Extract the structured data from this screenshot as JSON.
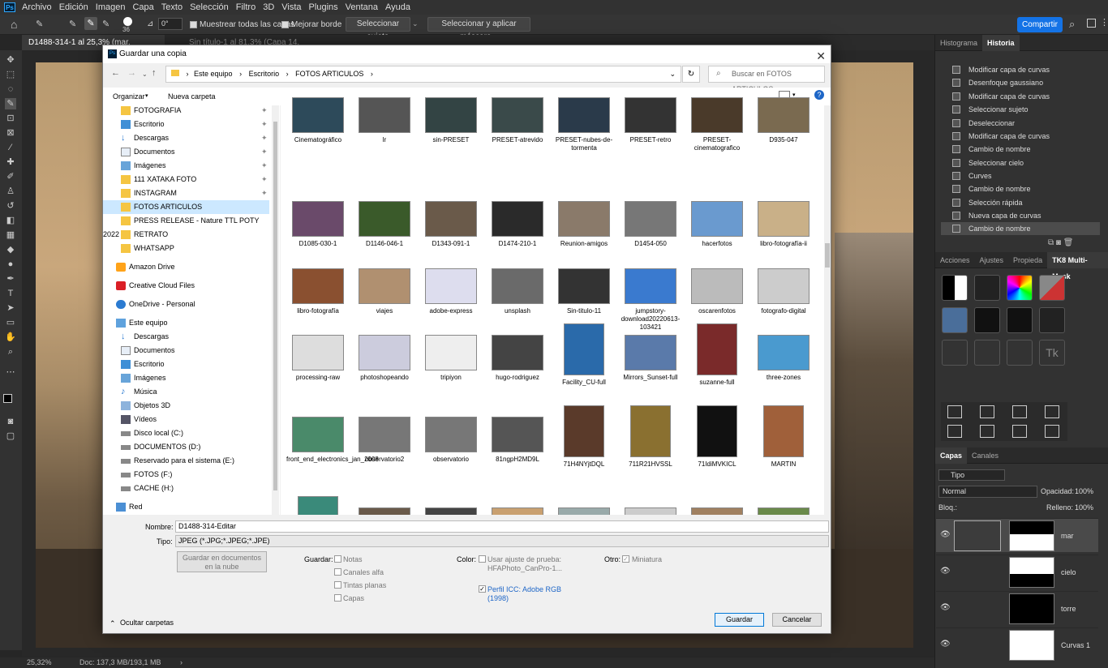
{
  "menubar": {
    "logo": "Ps",
    "items": [
      "Archivo",
      "Edición",
      "Imagen",
      "Capa",
      "Texto",
      "Selección",
      "Filtro",
      "3D",
      "Vista",
      "Plugins",
      "Ventana",
      "Ayuda"
    ]
  },
  "options": {
    "brush_size": "36",
    "angle": "0°",
    "sample_all": "Muestrear todas las capas",
    "improve_edge": "Mejorar borde",
    "select_subject": "Seleccionar sujeto",
    "select_mask": "Seleccionar y aplicar máscara...",
    "share": "Compartir"
  },
  "tabs": [
    "D1488-314-1 al 25,3% (mar, RGB/16) *",
    "Sin título-1 al 81,3% (Capa 14, RGB/8*) *"
  ],
  "status": {
    "zoom": "25,32%",
    "doc": "Doc: 137,3 MB/193,1 MB"
  },
  "history": {
    "tabs": [
      "Histograma",
      "Historia"
    ],
    "items": [
      "Modificar capa de curvas",
      "Desenfoque gaussiano",
      "Modificar capa de curvas",
      "Seleccionar sujeto",
      "Deseleccionar",
      "Modificar capa de curvas",
      "Cambio de nombre",
      "Seleccionar cielo",
      "Curves",
      "Cambio de nombre",
      "Selección rápida",
      "Nueva capa de curvas",
      "Cambio de nombre"
    ]
  },
  "tk8": {
    "tabs": [
      "Acciones",
      "Ajustes",
      "Propieda",
      "TK8 Multi-Mask"
    ],
    "tk_label": "Tk"
  },
  "layers": {
    "tabs": [
      "Capas",
      "Canales"
    ],
    "filter": "Tipo",
    "blend": "Normal",
    "opacity_label": "Opacidad:",
    "opacity": "100%",
    "lock_label": "Bloq.:",
    "fill_label": "Relleno:",
    "fill": "100%",
    "items": [
      "mar",
      "cielo",
      "torre",
      "Curvas 1"
    ]
  },
  "dialog": {
    "title": "Guardar una copia",
    "path": [
      "Este equipo",
      "Escritorio",
      "FOTOS ARTICULOS"
    ],
    "search": "Buscar en FOTOS ARTICULOS",
    "organize": "Organizar",
    "newfolder": "Nueva carpeta",
    "tree": [
      "FOTOGRAFIA",
      "Escritorio",
      "Descargas",
      "Documentos",
      "Imágenes",
      "111 XATAKA FOTO",
      "INSTAGRAM",
      "FOTOS ARTICULOS",
      "PRESS RELEASE - Nature TTL POTY 2022",
      "RETRATO",
      "WHATSAPP",
      "Amazon Drive",
      "Creative Cloud Files",
      "OneDrive - Personal",
      "Este equipo",
      "Descargas",
      "Documentos",
      "Escritorio",
      "Imágenes",
      "Música",
      "Objetos 3D",
      "Vídeos",
      "Disco local (C:)",
      "DOCUMENTOS (D:)",
      "Reservado para el sistema (E:)",
      "FOTOS (F:)",
      "CACHE (H:)",
      "Red"
    ],
    "files": [
      "Cinematográfico",
      "lr",
      "sin-PRESET",
      "PRESET-atrevido",
      "PRESET-nubes-de-tormenta",
      "PRESET-retro",
      "PRESET-cinematografico",
      "D935-047",
      "D1085-030-1",
      "D1146-046-1",
      "D1343-091-1",
      "D1474-210-1",
      "Reunion-amigos",
      "D1454-050",
      "hacerfotos",
      "libro-fotografía-ii",
      "libro-fotografía",
      "viajes",
      "adobe-express",
      "unsplash",
      "Sin-titulo-11",
      "jumpstory-download20220613-103421",
      "oscarenfotos",
      "fotografo-digital",
      "processing-raw",
      "photoshopeando",
      "tripiyon",
      "hugo-rodriguez",
      "Facility_CU-full",
      "Mirrors_Sunset-full",
      "suzanne-full",
      "three-zones",
      "front_end_electronics_jan_2008",
      "observatorio2",
      "observatorio",
      "81ngpH2MD9L",
      "71H4NYjtDQL",
      "711R21HVSSL",
      "71IdiMVKICL",
      "MARTIN",
      "MElado",
      "LIBROS",
      "D887-109-1",
      "D518-012-1",
      "IMG_0690",
      "B019-012",
      "D800-112-I",
      "D799-313"
    ],
    "name_label": "Nombre:",
    "name": "D1488-314-Editar",
    "type_label": "Tipo:",
    "type": "JPEG (*.JPG;*.JPEG;*.JPE)",
    "cloud": "Guardar en documentos en la nube",
    "save_label": "Guardar:",
    "save_opts": [
      "Notas",
      "Canales alfa",
      "Tintas planas",
      "Capas"
    ],
    "color_label": "Color:",
    "proof": "Usar ajuste de prueba: HFAPhoto_CanPro-1...",
    "icc": "Perfil ICC: Adobe RGB (1998)",
    "other_label": "Otro:",
    "thumb": "Miniatura",
    "hide": "Ocultar carpetas",
    "save_btn": "Guardar",
    "cancel_btn": "Cancelar"
  }
}
